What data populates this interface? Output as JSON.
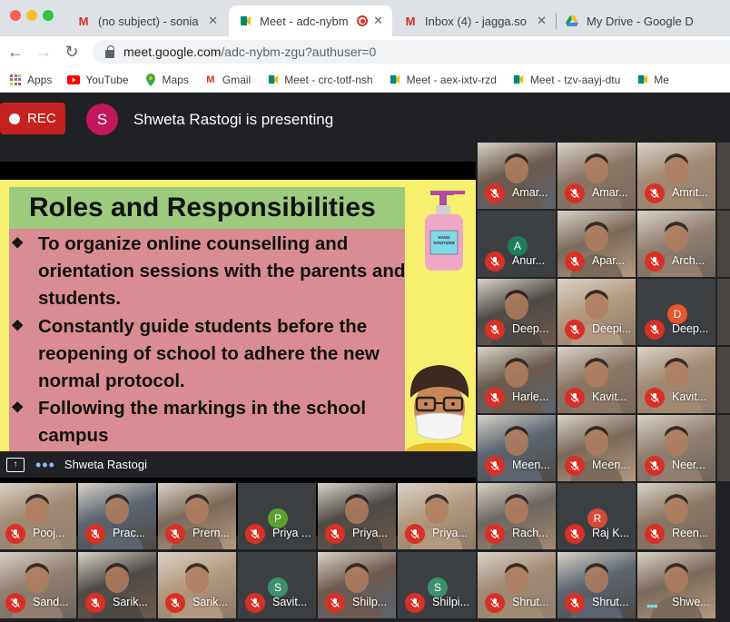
{
  "browser": {
    "tabs": [
      {
        "title": "(no subject) - sonia",
        "icon": "gmail-icon",
        "active": false
      },
      {
        "title": "Meet - adc-nybm",
        "icon": "meet-icon",
        "active": true
      },
      {
        "title": "Inbox (4) - jagga.so",
        "icon": "gmail-icon",
        "active": false
      },
      {
        "title": "My Drive - Google D",
        "icon": "drive-icon",
        "active": false
      }
    ],
    "url_host": "meet.google.com",
    "url_path": "/adc-nybm-zgu?authuser=0",
    "bookmarks": [
      {
        "label": "Apps",
        "icon": "apps-grid-icon"
      },
      {
        "label": "YouTube",
        "icon": "youtube-icon"
      },
      {
        "label": "Maps",
        "icon": "maps-icon"
      },
      {
        "label": "Gmail",
        "icon": "gmail-icon"
      },
      {
        "label": "Meet - crc-totf-nsh",
        "icon": "meet-icon"
      },
      {
        "label": "Meet - aex-ixtv-rzd",
        "icon": "meet-icon"
      },
      {
        "label": "Meet - tzv-aayj-dtu",
        "icon": "meet-icon"
      },
      {
        "label": "Me",
        "icon": "meet-icon"
      }
    ]
  },
  "meet": {
    "rec_label": "REC",
    "presenter_initial": "S",
    "presenting_text": "Shweta Rastogi is presenting",
    "presenter_name": "Shweta Rastogi",
    "slide": {
      "title": "Roles and Responsibilities",
      "bullet_symbol": "❖",
      "bullets": [
        "To organize online counselling and orientation sessions with the parents and students.",
        "Constantly guide students before the reopening of school to adhere the new normal protocol.",
        " Following the markings in the school campus"
      ],
      "sanitizer_label_1": "HAND",
      "sanitizer_label_2": "SANITIZER"
    },
    "participants_right": [
      {
        "name": "Amar...",
        "avatar": ""
      },
      {
        "name": "Amar...",
        "avatar": ""
      },
      {
        "name": "Amrit...",
        "avatar": ""
      },
      {
        "name": "Anur...",
        "avatar": "A"
      },
      {
        "name": "Apar...",
        "avatar": ""
      },
      {
        "name": "Arch...",
        "avatar": ""
      },
      {
        "name": "Deep...",
        "avatar": ""
      },
      {
        "name": "Deepi...",
        "avatar": ""
      },
      {
        "name": "Deep...",
        "avatar": "D"
      },
      {
        "name": "Harle...",
        "avatar": ""
      },
      {
        "name": "Kavit...",
        "avatar": ""
      },
      {
        "name": "Kavit...",
        "avatar": ""
      },
      {
        "name": "Meen...",
        "avatar": ""
      },
      {
        "name": "Meen...",
        "avatar": ""
      },
      {
        "name": "Neer...",
        "avatar": ""
      }
    ],
    "participants_bottom_1": [
      {
        "name": "Pooj...",
        "avatar": ""
      },
      {
        "name": "Prac...",
        "avatar": ""
      },
      {
        "name": "Prern...",
        "avatar": ""
      },
      {
        "name": "Priya ...",
        "avatar": "P"
      },
      {
        "name": "Priya...",
        "avatar": ""
      },
      {
        "name": "Priya...",
        "avatar": ""
      },
      {
        "name": "Rach...",
        "avatar": ""
      },
      {
        "name": "Raj K...",
        "avatar": "R"
      },
      {
        "name": "Reen...",
        "avatar": ""
      }
    ],
    "participants_bottom_2": [
      {
        "name": "Sand...",
        "avatar": ""
      },
      {
        "name": "Sarik...",
        "avatar": ""
      },
      {
        "name": "Sarik...",
        "avatar": ""
      },
      {
        "name": "Savit...",
        "avatar": "S"
      },
      {
        "name": "Shilp...",
        "avatar": ""
      },
      {
        "name": "Shilpi...",
        "avatar": "S"
      },
      {
        "name": "Shrut...",
        "avatar": ""
      },
      {
        "name": "Shrut...",
        "avatar": ""
      },
      {
        "name": "Shwe...",
        "avatar": ""
      }
    ]
  }
}
